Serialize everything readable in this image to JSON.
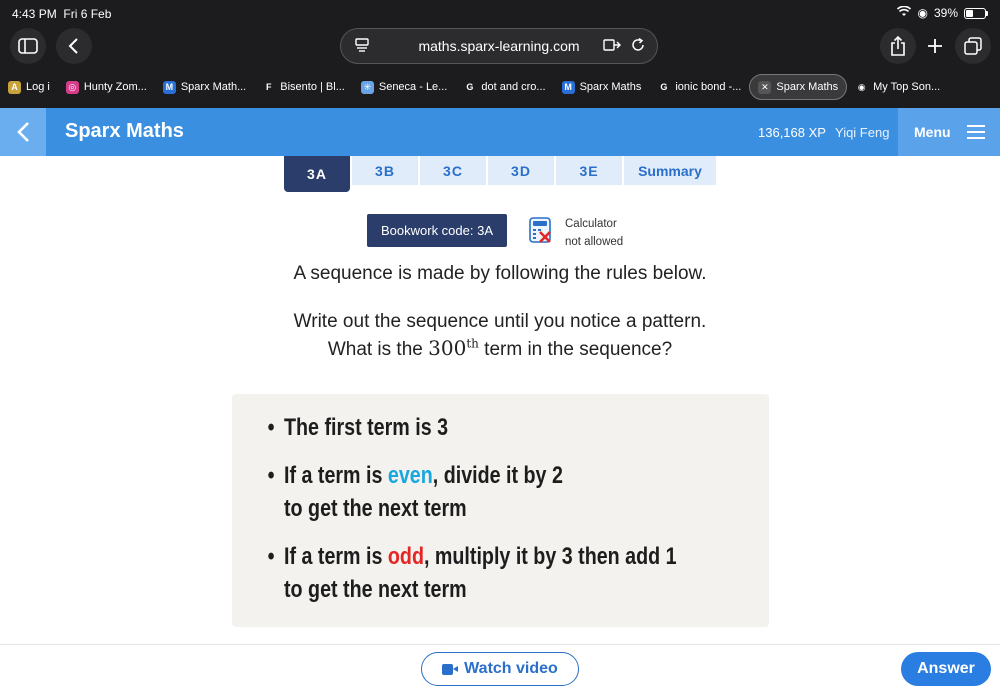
{
  "status": {
    "time": "4:43 PM",
    "date": "Fri 6 Feb",
    "battery": "39%",
    "battery_level": 0.39
  },
  "browser": {
    "url": "maths.sparx-learning.com",
    "bookmarks": [
      {
        "label": "Log i",
        "icon_color": "#c8a23a",
        "icon_char": "A"
      },
      {
        "label": "Hunty Zom...",
        "icon_color": "#d63c8a",
        "icon_char": "◎"
      },
      {
        "label": "Sparx Math...",
        "icon_color": "#2a6fd6",
        "icon_char": "M"
      },
      {
        "label": "Bisento | Bl...",
        "icon_color": "#1c1c1e",
        "icon_char": "F"
      },
      {
        "label": "Seneca - Le...",
        "icon_color": "#6ba4e6",
        "icon_char": "✳"
      },
      {
        "label": "dot and cro...",
        "icon_color": "#1c1c1e",
        "icon_char": "G"
      },
      {
        "label": "Sparx Maths",
        "icon_color": "#2a6fd6",
        "icon_char": "M"
      },
      {
        "label": "ionic bond -...",
        "icon_color": "#1c1c1e",
        "icon_char": "G"
      },
      {
        "label": "Sparx Maths",
        "icon_color": "#555555",
        "icon_char": "✕"
      },
      {
        "label": "My Top Son...",
        "icon_color": "#1c1c1e",
        "icon_char": "◉"
      }
    ]
  },
  "header": {
    "brand": "Sparx Maths",
    "xp": "136,168 XP",
    "user": "Yiqi Feng",
    "menu_label": "Menu"
  },
  "tabs": [
    "3A",
    "3B",
    "3C",
    "3D",
    "3E",
    "Summary"
  ],
  "bookwork": {
    "label": "Bookwork code: 3A",
    "calc_line1": "Calculator",
    "calc_line2": "not allowed"
  },
  "question": {
    "line1": "A sequence is made by following the rules below.",
    "line2": "Write out the sequence until you notice a pattern.",
    "line3_pre": "What is the ",
    "line3_num": "300",
    "line3_sup": "th",
    "line3_post": " term in the sequence?"
  },
  "rules": {
    "r1": "The first term is 3",
    "r2_pre": "If a term is ",
    "r2_word": "even",
    "r2_post": ", divide it by 2",
    "r2_line2": "to get the next term",
    "r3_pre": "If a term is ",
    "r3_word": "odd",
    "r3_post": ", multiply it by 3 then add 1",
    "r3_line2": "to get the next term"
  },
  "footer": {
    "watch_label": "Watch video",
    "answer_label": "Answer"
  },
  "colors": {
    "brand_blue": "#3b8fe0",
    "tab_active": "#2a3d6b",
    "even": "#19a7e0",
    "odd": "#e32626"
  }
}
